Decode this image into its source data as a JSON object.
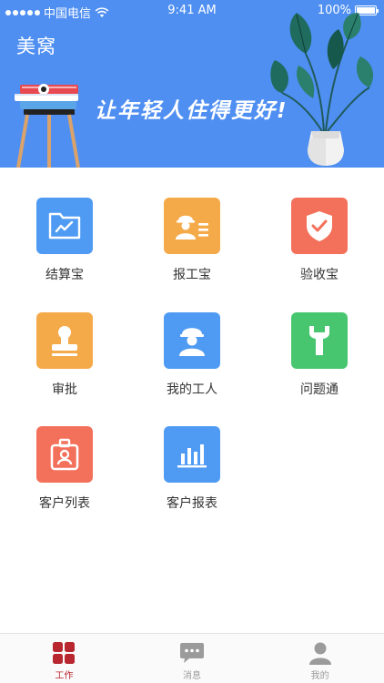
{
  "status_bar": {
    "carrier": "中国电信",
    "time": "9:41 AM",
    "battery": "100%"
  },
  "header": {
    "title": "美窝",
    "slogan": "让年轻人住得更好!"
  },
  "menu": [
    {
      "label": "结算宝",
      "icon": "chart-folder-icon",
      "color": "#4f9bf4"
    },
    {
      "label": "报工宝",
      "icon": "worker-list-icon",
      "color": "#f5aa4a"
    },
    {
      "label": "验收宝",
      "icon": "shield-check-icon",
      "color": "#f3705a"
    },
    {
      "label": "审批",
      "icon": "stamp-icon",
      "color": "#f5aa4a"
    },
    {
      "label": "我的工人",
      "icon": "worker-icon",
      "color": "#4f9bf4"
    },
    {
      "label": "问题通",
      "icon": "wrench-icon",
      "color": "#48c66f"
    },
    {
      "label": "客户列表",
      "icon": "client-badge-icon",
      "color": "#f3705a"
    },
    {
      "label": "客户报表",
      "icon": "bar-chart-icon",
      "color": "#4f9bf4"
    }
  ],
  "tabbar": {
    "active": "工作",
    "tabs": [
      {
        "label": "工作",
        "icon": "grid-icon",
        "active": true,
        "color": "#b8262f"
      },
      {
        "label": "消息",
        "icon": "chat-bubble-icon",
        "active": false,
        "color": "#9b9b9b"
      },
      {
        "label": "我的",
        "icon": "person-icon",
        "active": false,
        "color": "#9b9b9b"
      }
    ]
  }
}
